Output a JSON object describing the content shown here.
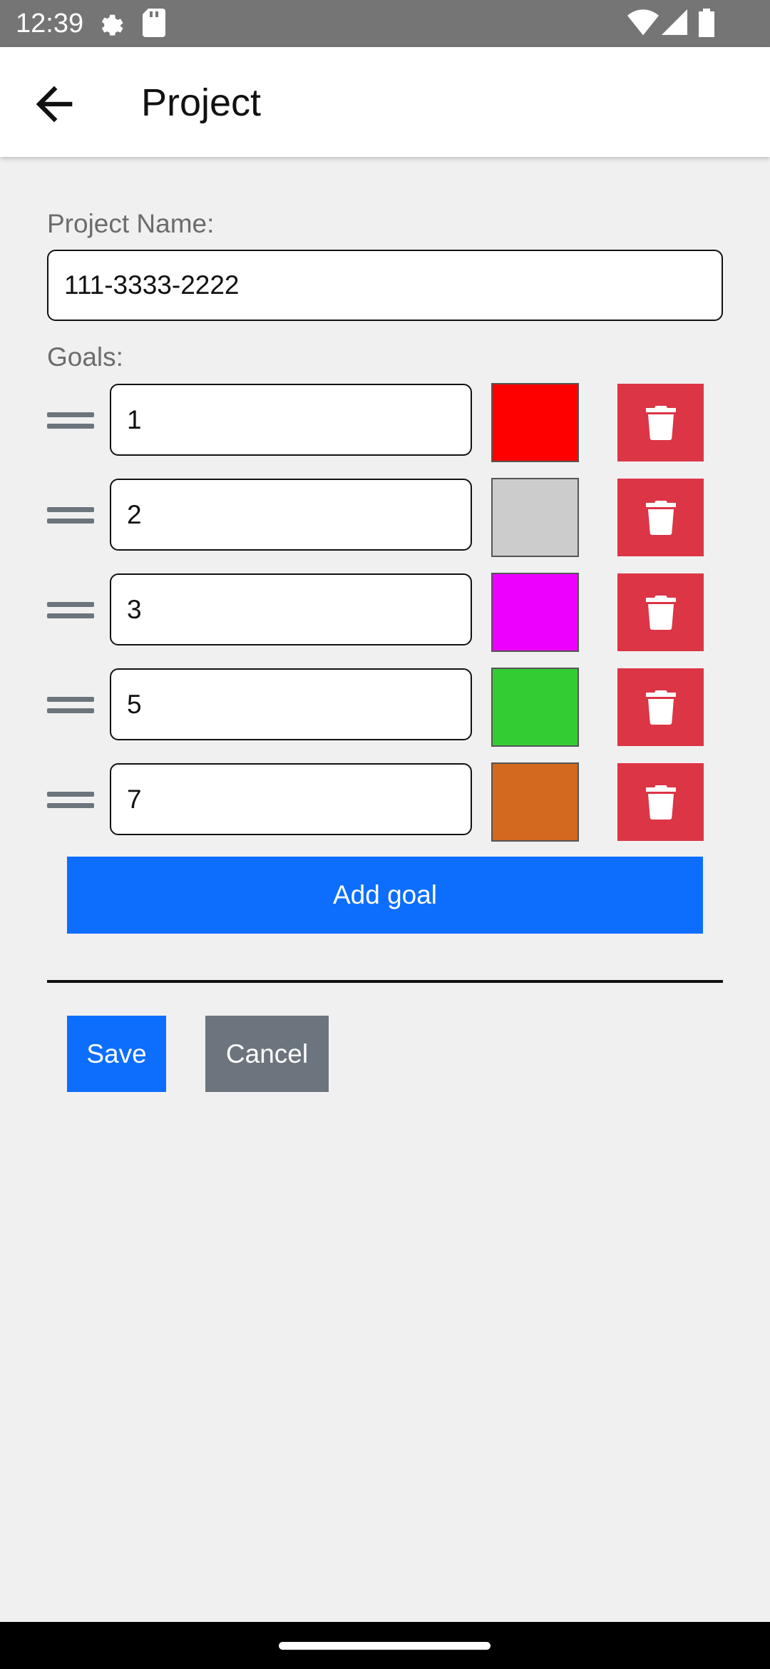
{
  "status_bar": {
    "time": "12:39",
    "icons": [
      "settings-gear-icon",
      "sd-card-icon",
      "wifi-icon",
      "cell-signal-icon",
      "battery-icon"
    ]
  },
  "app_bar": {
    "title": "Project",
    "back_icon": "arrow-left-icon"
  },
  "form": {
    "project_name_label": "Project Name:",
    "project_name_value": "111-3333-2222",
    "goals_label": "Goals:",
    "goals": [
      {
        "value": "1",
        "color": "#ff0000"
      },
      {
        "value": "2",
        "color": "#cccccc"
      },
      {
        "value": "3",
        "color": "#ee00ff"
      },
      {
        "value": "5",
        "color": "#33cc33"
      },
      {
        "value": "7",
        "color": "#d2691e"
      }
    ],
    "add_goal_label": "Add goal",
    "save_label": "Save",
    "cancel_label": "Cancel",
    "colors": {
      "primary": "#0d6efd",
      "danger": "#dc3545",
      "secondary": "#6c757d"
    }
  }
}
